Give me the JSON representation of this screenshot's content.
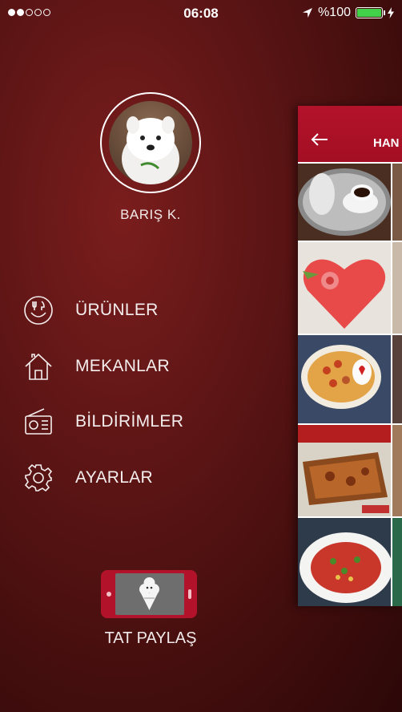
{
  "status": {
    "signal_dots": [
      true,
      true,
      false,
      false,
      false
    ],
    "time": "06:08",
    "battery_text": "%100",
    "battery_level": 1.0,
    "battery_color": "#41d24a"
  },
  "profile": {
    "name": "BARIŞ K."
  },
  "menu": {
    "items": [
      {
        "label": "ÜRÜNLER",
        "icon": "utensils-plate-icon"
      },
      {
        "label": "MEKANLAR",
        "icon": "house-icon"
      },
      {
        "label": "BİLDİRİMLER",
        "icon": "radio-icon"
      },
      {
        "label": "AYARLAR",
        "icon": "gear-icon"
      }
    ]
  },
  "brand": {
    "label": "TAT PAYLAŞ",
    "logo_icon": "phone-ice-cream-icon",
    "accent": "#b3132a"
  },
  "panel": {
    "title": "HAN",
    "back_icon": "arrow-left-icon",
    "header_color": "#b3132a",
    "photos": [
      "turkish-coffee-photo",
      "heart-cake-photo",
      "meze-plate-photo",
      "pizza-photo",
      "salad-photo"
    ]
  },
  "colors": {
    "background_dark": "#3e0c0c",
    "background_mid": "#7a1d1d"
  }
}
